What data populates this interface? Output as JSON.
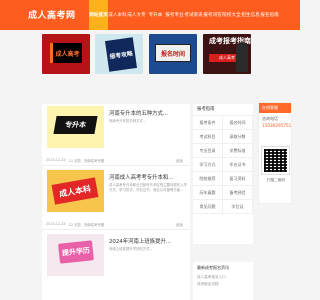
{
  "header": {
    "logo": "成人高考网",
    "nav": [
      "网站首页",
      "成人本科",
      "成人大专",
      "专升本",
      "报考专业",
      "考试资讯",
      "报考问答",
      "院校大全",
      "招生信息",
      "报名指南"
    ]
  },
  "banners": [
    {
      "text": "成人高考"
    },
    {
      "text": "报考攻略"
    },
    {
      "text": "报名时间"
    },
    {
      "title": "成考报考指南",
      "stripe": "成人高考"
    }
  ],
  "articles": [
    {
      "thumb": "专升本",
      "title": "河南专升本的五种方式...",
      "desc": "河南专升本的五种方式...",
      "date": "2023-12-25",
      "views": "11 浏览",
      "category": "河南成考专题",
      "more": "阅读"
    },
    {
      "thumb": "成人本科",
      "title": "河南成人高考考专升本和...",
      "desc": "成人高考专升本和全日制专升本区别主要体现在入学方式、学习形式、毕业证书、就业认可度等方面...",
      "date": "2023-12-25",
      "views": "12 浏览",
      "category": "河南成考专题",
      "more": "阅读"
    },
    {
      "thumb": "提升学历",
      "title": "2024年河南上班族提升...",
      "desc": "河南上班族提升学历的方式...",
      "date": "",
      "views": "",
      "category": "",
      "more": ""
    }
  ],
  "categories": {
    "title": "报考指南",
    "items": [
      "报考条件",
      "报名时间",
      "考试科目",
      "录取分数",
      "专业目录",
      "学费标准",
      "学习方式",
      "毕业证书",
      "院校推荐",
      "复习资料",
      "历年真题",
      "备考经验",
      "常见问题",
      "学位证"
    ]
  },
  "contact": {
    "title": "在线客服",
    "label": "咨询电话",
    "phone": "15036295751",
    "caption": "扫描二维码"
  },
  "side2": {
    "title": "最新成考报名资讯",
    "items": [
      "成人高考报名入口",
      "成考报名流程"
    ]
  }
}
